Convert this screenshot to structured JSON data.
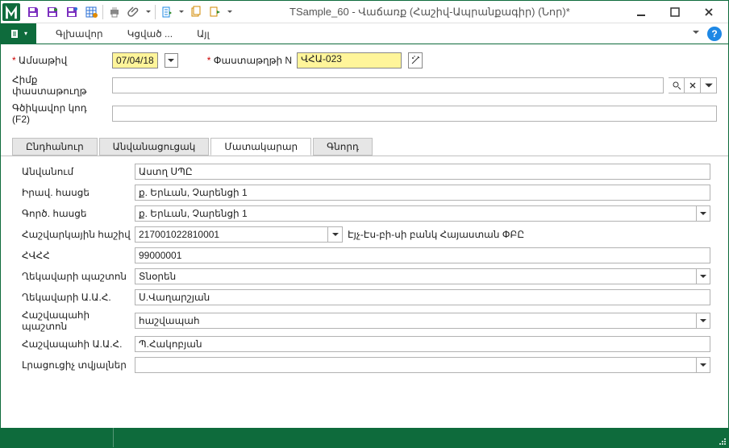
{
  "title": "TSample_60 - Վաճառք (Հաշիվ-Ապրանքագիր) (Նոր)*",
  "menu": {
    "item1": "Գլխավոր",
    "item2": "Կցված ...",
    "item3": "Այլ"
  },
  "header": {
    "date_label": "Ամսաթիվ",
    "date_value": "07/04/18",
    "docn_label": "Փաստաթղթի N",
    "docn_value": "ՎՀԱ-023",
    "base_label": "Հիմք փաստաթուղթ",
    "base_value": "",
    "partner_label": "Գծիկավոր կոդ (F2)",
    "partner_value": ""
  },
  "tabs": {
    "t1": "Ընդհանուր",
    "t2": "Անվանացուցակ",
    "t3": "Մատակարար",
    "t4": "Գնորդ"
  },
  "supplier": {
    "r1_label": "Անվանում",
    "r1_value": "Աստղ ՍՊԸ",
    "r2_label": "Իրավ. հասցե",
    "r2_value": "ք. Երևան, Չարենցի 1",
    "r3_label": "Գործ. հասցե",
    "r3_value": "ք. Երևան, Չարենցի 1",
    "r4_label": "Հաշվարկային հաշիվ",
    "r4_value": "217001022810001",
    "r4_bank": "Էյչ-Էս-բի-սի բանկ Հայաստան ՓԲԸ",
    "r5_label": "ՀՎՀՀ",
    "r5_value": "99000001",
    "r6_label": "Ղեկավարի պաշտոն",
    "r6_value": "Տնօրեն",
    "r7_label": "Ղեկավարի Ա.Ա.Հ.",
    "r7_value": "Ս.Վաղարշյան",
    "r8_label": "Հաշվապահի պաշտոն",
    "r8_value": "հաշվապահ",
    "r9_label": "Հաշվապահի Ա.Ա.Հ.",
    "r9_value": "Պ.Հակոբյան",
    "r10_label": "Լրացուցիչ տվյալներ",
    "r10_value": ""
  }
}
